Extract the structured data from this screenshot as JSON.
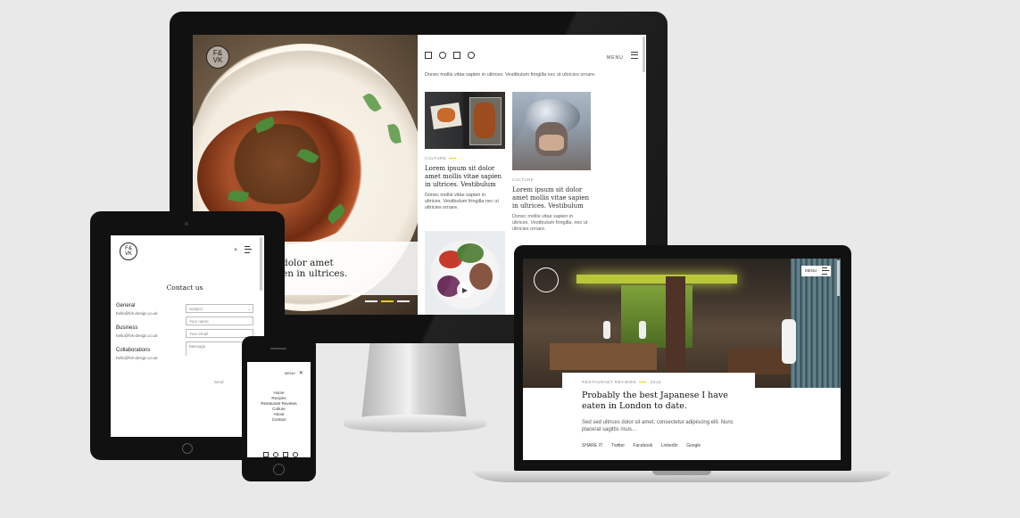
{
  "desktop": {
    "logo": {
      "line1": "F&",
      "line2": "VK"
    },
    "menu_label": "MENU",
    "hero_caption": {
      "line1": "dolor amet",
      "line2": "en in ultrices."
    },
    "intro": "Donec mollis vitae sapien in ultrices. Vestibulum fringilla nec ut ultricies ornare.",
    "cards": [
      {
        "category": "CULTURE",
        "title": "Lorem ipsum sit dolor amet mollis vitae sapien in ultrices. Vestibulum",
        "excerpt": "Donec mollis vitae sapien in ultrices. Vestibulum fringilla nec ut ultricies ornare."
      },
      {
        "category": "CULTURE",
        "title": "Lorem ipsum sit dolor amet mollis vitae sapien in ultrices. Vestibulum",
        "excerpt": "Donec mollis vitae sapien in ultrices. Vestibulum fringilla, nec ut ultricies ornare."
      }
    ]
  },
  "tablet": {
    "logo": {
      "line1": "F&",
      "line2": "VK"
    },
    "heading": "Contact us",
    "contacts": [
      {
        "label": "General",
        "email": "hello@fvk-design.co.uk"
      },
      {
        "label": "Business",
        "email": "hello@fvk-design.co.uk"
      },
      {
        "label": "Collaborations",
        "email": "hello@fvk-design.co.uk"
      }
    ],
    "fields": [
      "Subject",
      "Your name",
      "Your email",
      "Message"
    ],
    "send_label": "Send"
  },
  "phone": {
    "menu_label": "MENU",
    "menu_items": [
      "Home",
      "Recipes",
      "Restaurant Reviews",
      "Culture",
      "About",
      "Contact"
    ]
  },
  "laptop": {
    "menu_label": "MENU",
    "category": "RESTAURANT REVIEWS",
    "date": "2015",
    "title": "Probably the best Japanese I have eaten in London to date.",
    "excerpt": "Sed sed ultrices dolor sit amet, consectetur adipiscing elit. Nunc placerat sagittis risus...",
    "share_label": "SHARE IT:",
    "share_links": [
      "Twitter",
      "Facebook",
      "LinkedIn",
      "Google"
    ]
  }
}
